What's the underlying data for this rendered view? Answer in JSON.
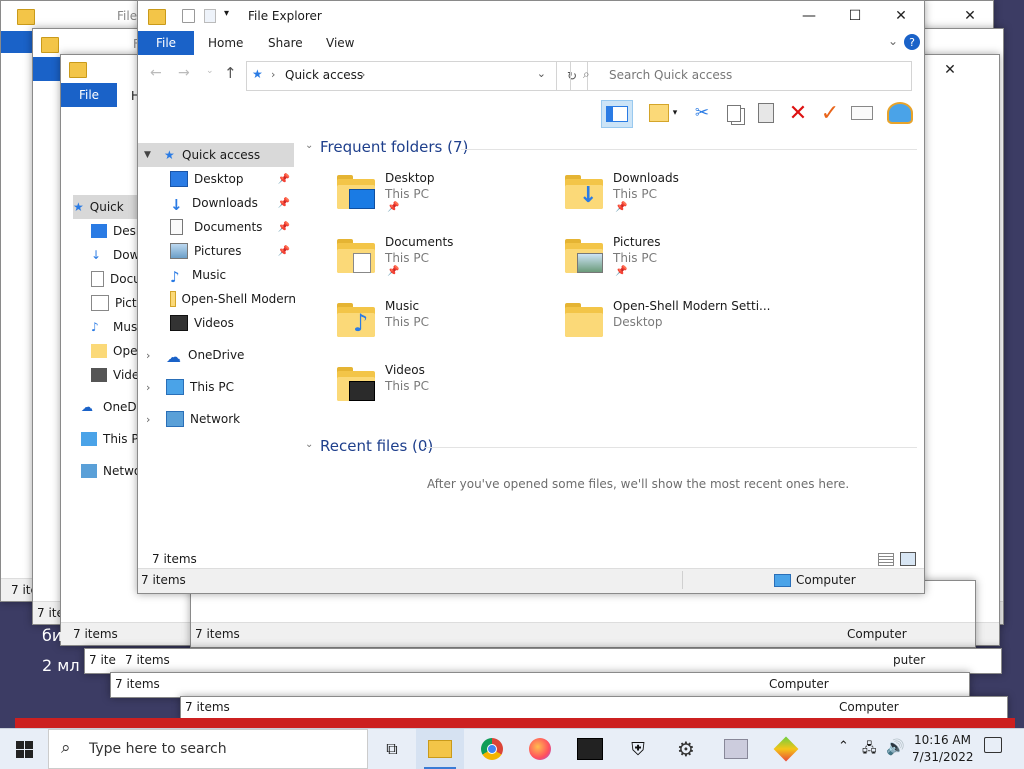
{
  "window": {
    "title": "File Explorer",
    "ribbon_tabs": [
      "File",
      "Home",
      "Share",
      "View"
    ],
    "address": {
      "path": "Quick access"
    },
    "search": {
      "placeholder": "Search Quick access"
    },
    "nav_pane": [
      {
        "label": "Quick access",
        "icon": "star-icon",
        "pinned": false,
        "level": 0,
        "selected": true
      },
      {
        "label": "Desktop",
        "icon": "desktop-icon",
        "pinned": true,
        "level": 1
      },
      {
        "label": "Downloads",
        "icon": "download-icon",
        "pinned": true,
        "level": 1
      },
      {
        "label": "Documents",
        "icon": "document-icon",
        "pinned": true,
        "level": 1
      },
      {
        "label": "Pictures",
        "icon": "picture-icon",
        "pinned": true,
        "level": 1
      },
      {
        "label": "Music",
        "icon": "music-icon",
        "pinned": false,
        "level": 1
      },
      {
        "label": "Open-Shell Modern",
        "icon": "folder-icon",
        "pinned": false,
        "level": 1
      },
      {
        "label": "Videos",
        "icon": "video-icon",
        "pinned": false,
        "level": 1
      },
      {
        "label": "OneDrive",
        "icon": "cloud-icon",
        "level": 0
      },
      {
        "label": "This PC",
        "icon": "computer-icon",
        "level": 0
      },
      {
        "label": "Network",
        "icon": "network-icon",
        "level": 0
      }
    ],
    "frequent_header": "Frequent folders (7)",
    "frequent": [
      {
        "name": "Desktop",
        "location": "This PC",
        "pinned": true,
        "icon": "desktop-folder-icon"
      },
      {
        "name": "Downloads",
        "location": "This PC",
        "pinned": true,
        "icon": "downloads-folder-icon"
      },
      {
        "name": "Documents",
        "location": "This PC",
        "pinned": true,
        "icon": "documents-folder-icon"
      },
      {
        "name": "Pictures",
        "location": "This PC",
        "pinned": true,
        "icon": "pictures-folder-icon"
      },
      {
        "name": "Music",
        "location": "This PC",
        "pinned": false,
        "icon": "music-folder-icon"
      },
      {
        "name": "Open-Shell Modern Setti...",
        "location": "Desktop",
        "pinned": false,
        "icon": "folder-icon"
      },
      {
        "name": "Videos",
        "location": "This PC",
        "pinned": false,
        "icon": "videos-folder-icon"
      }
    ],
    "recent_header": "Recent files (0)",
    "recent_empty": "After you've opened some files, we'll show the most recent ones here.",
    "status_items": "7 items",
    "status_items2": "7 items",
    "status_location": "Computer"
  },
  "background_windows": {
    "title_fragment": "File",
    "file_tab": "File",
    "home_fragment": "H",
    "nav_fragments": [
      "Quick",
      "Desk",
      "Dow",
      "Docu",
      "Pictu",
      "Mus",
      "Oper",
      "Vide",
      "OneDr",
      "This P",
      "Netwo"
    ],
    "status_items": "7 items",
    "status_item_fragment": "7 ite",
    "status_location": "Computer",
    "status_location_fragment": "puter"
  },
  "desktop_text": [
    "би",
    "2 мл"
  ],
  "taskbar": {
    "search_placeholder": "Type here to search",
    "time": "10:16 AM",
    "date": "7/31/2022",
    "apps": [
      "task-view-icon",
      "file-explorer-icon",
      "chrome-icon",
      "firefox-icon",
      "start-tool-icon",
      "defender-icon",
      "settings-icon",
      "monitor-app-icon",
      "bluestacks-icon"
    ]
  }
}
